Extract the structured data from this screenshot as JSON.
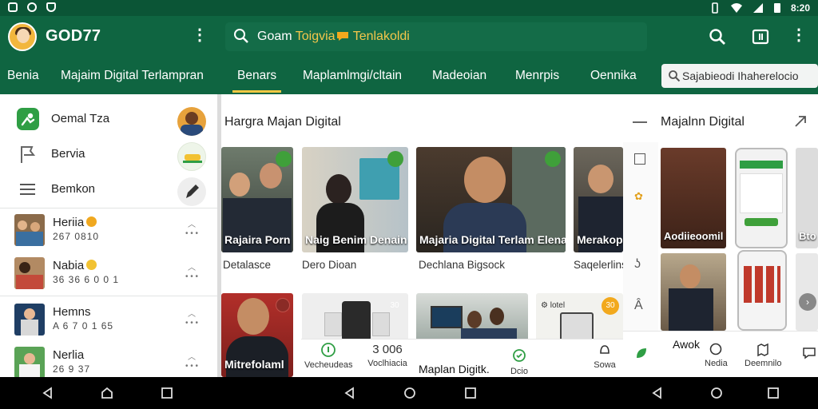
{
  "status_bar": {
    "time": "8:20"
  },
  "app": {
    "title": "GOD77",
    "menu_icon": "more-vert-icon",
    "search": {
      "text_prefix": "Goam ",
      "text_highlight": "Toigvia",
      "text_suffix": " Tenlakoldi",
      "icon": "search-icon"
    },
    "actions": [
      "search-icon",
      "tab-icon",
      "more-vert-icon"
    ]
  },
  "tabs": {
    "items": [
      {
        "label": "Benia"
      },
      {
        "label": "Majaim Digital Terlampran"
      },
      {
        "label": "Benars",
        "active": true
      },
      {
        "label": "Maplamlmgi/cltain"
      },
      {
        "label": "Madeoian"
      },
      {
        "label": "Menrpis"
      },
      {
        "label": "Oennika"
      }
    ],
    "search_placeholder": "Sajabieodi Ihaherelocio"
  },
  "left_panel": {
    "menu": [
      {
        "label": "Oemal Tza",
        "icon": "people-icon"
      },
      {
        "label": "Bervia",
        "icon": "flag-icon"
      },
      {
        "label": "Bemkon",
        "icon": "list-icon"
      }
    ],
    "contacts": [
      {
        "name": "Heriia",
        "number": "267 0810"
      },
      {
        "name": "Nabia",
        "number": "36 36 6 0 0 1"
      },
      {
        "name": "Hemns",
        "number": "A 6 7 0 1 65"
      },
      {
        "name": "Nerlia",
        "number": "26 9 37"
      }
    ]
  },
  "content": {
    "section_title": "Hargra Majan Digital",
    "cards_row1": [
      {
        "caption": "Rajaira Porn",
        "subtitle": "Detalasce"
      },
      {
        "caption": "Naig Benim Denain",
        "subtitle": "Dero Dioan"
      },
      {
        "caption": "Majaria Digital Terlam Elenal",
        "subtitle": "Dechlana Bigsock"
      },
      {
        "caption": "Merakop",
        "subtitle": "Saqelerlins"
      }
    ],
    "cards_row2": [
      {
        "caption": "Mitrefolaml"
      },
      {
        "caption": ""
      },
      {
        "caption": "Maplan Digitk."
      },
      {
        "caption": ""
      }
    ],
    "row2_badges": [
      "30",
      "30"
    ],
    "bottom_strip": [
      {
        "label": "Vecheudeas"
      },
      {
        "label": "Voclhiacia",
        "top": "3 006"
      },
      {
        "label": "Dcio"
      },
      {
        "label": "Sowa"
      }
    ]
  },
  "right_panel": {
    "title": "Majalnn Digital",
    "tiles": [
      {
        "caption": "Aodiieoomil"
      },
      {
        "caption": "Bto"
      }
    ],
    "nav": [
      {
        "label": "Awok"
      },
      {
        "label": "Nedia"
      },
      {
        "label": "Deemnilo"
      }
    ]
  },
  "colors": {
    "primary": "#0f6541",
    "accent": "#f5c843",
    "badge_green": "#3fa03a",
    "badge_orange": "#f2a91d"
  }
}
